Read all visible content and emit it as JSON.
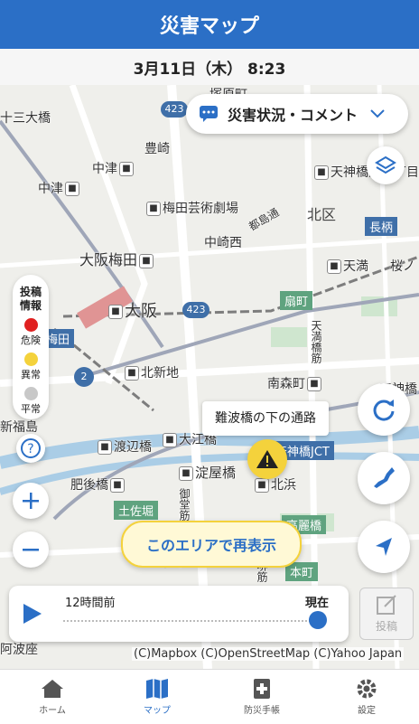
{
  "app": {
    "title": "災害マップ"
  },
  "datetime": "3月11日（木） 8:23",
  "filter": {
    "label": "災害状況・コメント"
  },
  "legend": {
    "title_line1": "投稿",
    "title_line2": "情報",
    "items": [
      {
        "label": "危険",
        "color": "#e02020"
      },
      {
        "label": "異常",
        "color": "#f4d23c"
      },
      {
        "label": "平常",
        "color": "#c8c8c8"
      }
    ]
  },
  "map": {
    "labels": [
      "十三大橋",
      "豊崎",
      "中津",
      "中津",
      "梅田芸術劇場",
      "中崎西",
      "大阪梅田",
      "大阪",
      "北新地",
      "渡辺橋",
      "大江橋",
      "淀屋橋",
      "北浜",
      "肥後橋",
      "土佐堀",
      "南森町",
      "天満",
      "天神橋筋六丁目",
      "北区",
      "扇町",
      "高麗橋",
      "本町",
      "阿波座",
      "天神橋",
      "天神橋JCT",
      "梅田",
      "新福島",
      "都島通",
      "御堂筋",
      "長柄",
      "桜ノ",
      "天満橋筋",
      "塚原町",
      "堺筋",
      "本町"
    ],
    "routes": [
      "423",
      "423",
      "2"
    ],
    "callout": "難波橋の下の通路"
  },
  "refresh_area": "このエリアで再表示",
  "timeline": {
    "start_label": "12時間前",
    "end_label": "現在",
    "position_fraction": 1.0
  },
  "post_button": "投稿",
  "attribution": "(C)Mapbox (C)OpenStreetMap (C)Yahoo Japan",
  "tabs": [
    {
      "label": "ホーム",
      "icon": "home-icon"
    },
    {
      "label": "マップ",
      "icon": "map-icon"
    },
    {
      "label": "防災手帳",
      "icon": "notebook-icon"
    },
    {
      "label": "設定",
      "icon": "gear-icon"
    }
  ],
  "colors": {
    "accent": "#2b6fc6",
    "danger": "#e02020",
    "warning": "#f4d23c"
  }
}
